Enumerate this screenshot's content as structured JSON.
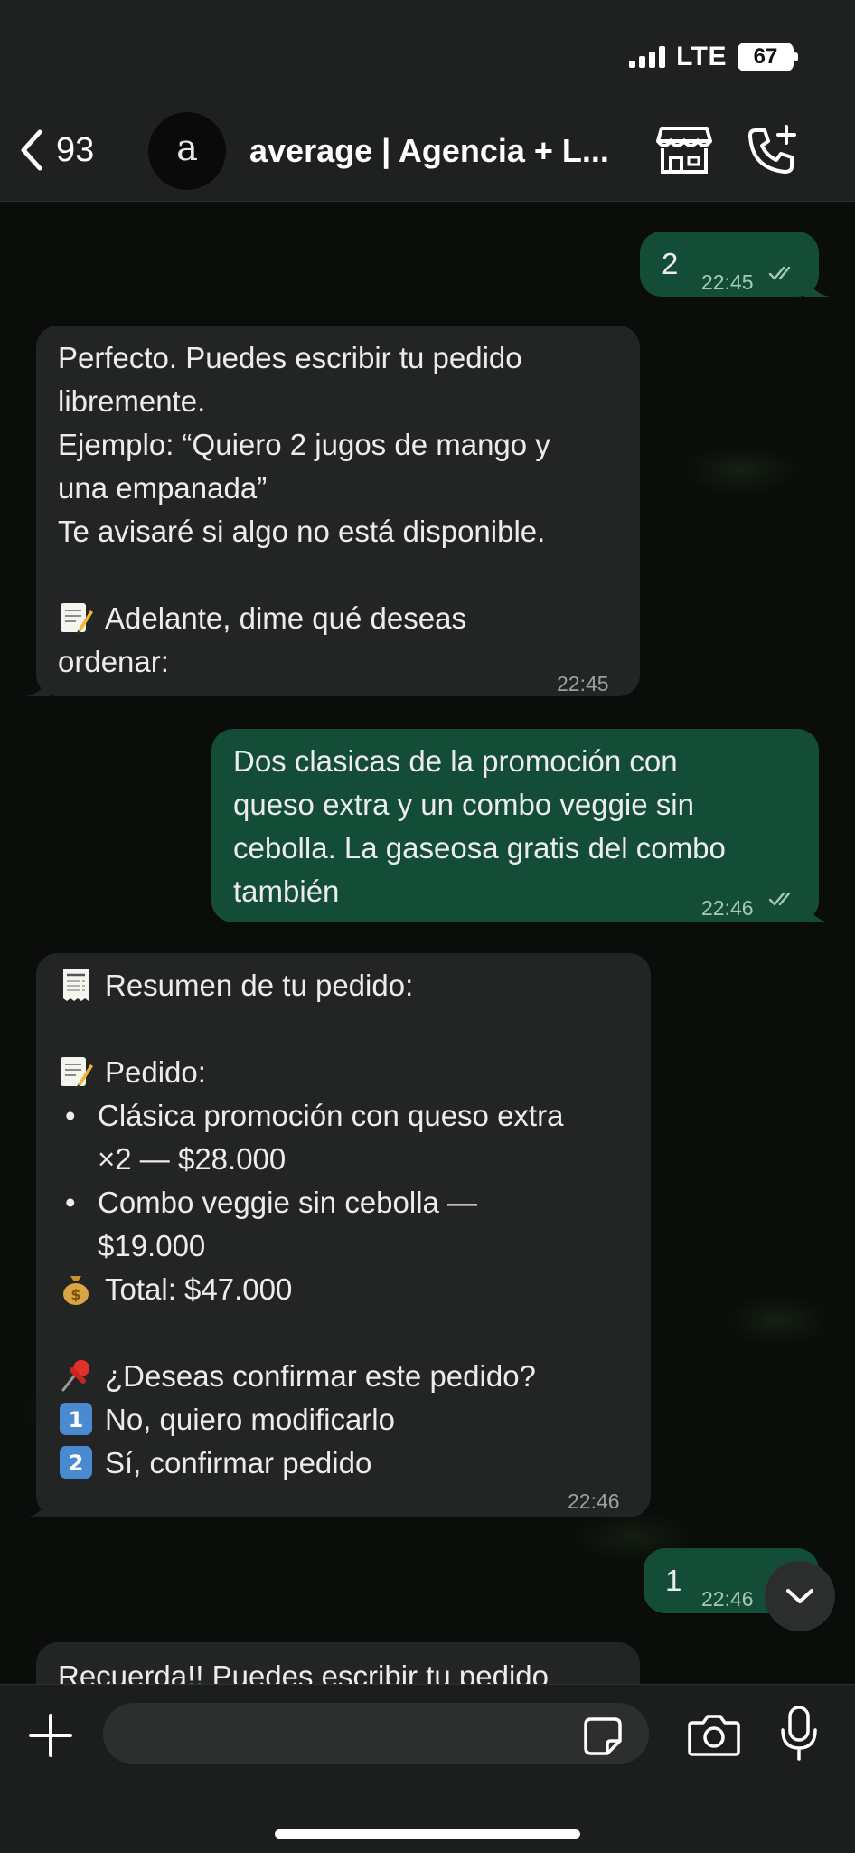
{
  "status_bar": {
    "network": "LTE",
    "battery": "67"
  },
  "header": {
    "back_count": "93",
    "avatar_letter": "a",
    "chat_title": "average | Agencia + L..."
  },
  "messages": [
    {
      "id": "m1",
      "direction": "outgoing",
      "lines": [
        "2"
      ],
      "time": "22:45",
      "status": "read"
    },
    {
      "id": "m2",
      "direction": "incoming",
      "lines": [
        "Perfecto. Puedes escribir tu pedido",
        "libremente.",
        "Ejemplo: “Quiero 2 jugos de mango y",
        "una empanada”",
        "Te avisaré si algo no está disponible.",
        "",
        "Adelante, dime qué deseas",
        "ordenar:"
      ],
      "time": "22:45"
    },
    {
      "id": "m3",
      "direction": "outgoing",
      "lines": [
        "Dos clasicas de la promoción con",
        "queso extra y un combo veggie sin",
        "cebolla. La gaseosa gratis del combo",
        "también"
      ],
      "time": "22:46",
      "status": "read"
    },
    {
      "id": "m4",
      "direction": "incoming",
      "time": "22:46",
      "summary_title": "Resumen de tu pedido:",
      "order_label": "Pedido:",
      "items": [
        {
          "line1": "Clásica promoción con queso extra",
          "line2": "×2 — $28.000"
        },
        {
          "line1": "Combo veggie sin cebolla —",
          "line2": "$19.000"
        }
      ],
      "total": "Total: $47.000",
      "confirm_question": "¿Deseas confirmar este pedido?",
      "option1": "No, quiero modificarlo",
      "option2": "Sí, confirmar pedido",
      "option1_key": "1",
      "option2_key": "2"
    },
    {
      "id": "m5",
      "direction": "outgoing",
      "lines": [
        "1"
      ],
      "time": "22:46"
    },
    {
      "id": "m6",
      "direction": "incoming",
      "lines": [
        "Recuerda!! Puedes escribir tu pedido"
      ]
    }
  ],
  "composer": {
    "placeholder": ""
  },
  "icons": {
    "back": "chevron-left-icon",
    "store": "storefront-icon",
    "call": "phone-add-icon",
    "plus": "plus-icon",
    "sticker": "sticker-icon",
    "camera": "camera-icon",
    "mic": "microphone-icon",
    "scroll": "chevron-down-icon"
  },
  "colors": {
    "outgoing_bubble": "#144d37",
    "incoming_bubble": "#232524",
    "background": "#0b0d0b"
  }
}
